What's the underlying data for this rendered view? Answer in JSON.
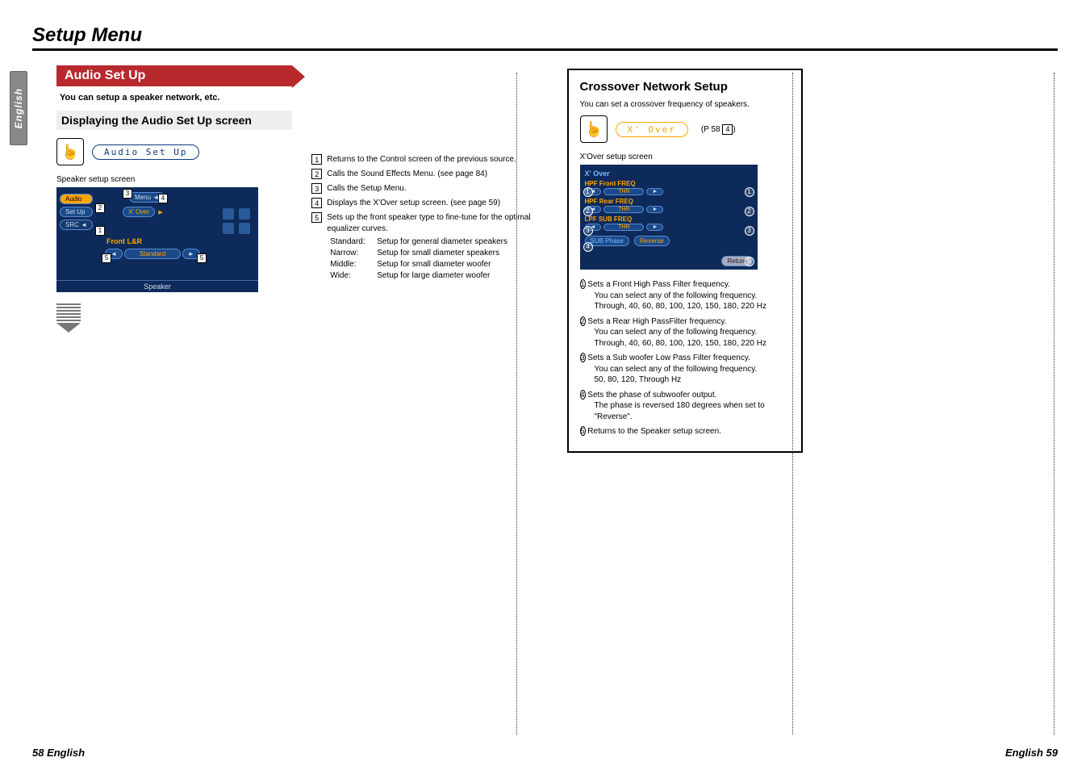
{
  "page_title": "Setup Menu",
  "english_tab": "English",
  "left_page": {
    "banner": "Audio Set Up",
    "intro": "You can setup a speaker network, etc.",
    "subheading": "Displaying the Audio Set Up screen",
    "button_pill": "Audio Set Up",
    "speaker_label": "Speaker setup screen",
    "screen": {
      "tabs": {
        "audio": "Audio",
        "setup": "Set Up",
        "src": "SRC"
      },
      "menu": "Menu",
      "xover": "X' Over",
      "front": "Front L&R",
      "standard": "Standard",
      "footer": "Speaker"
    },
    "items": [
      {
        "n": "1",
        "text": "Returns to the Control screen of the previous source."
      },
      {
        "n": "2",
        "text": "Calls the Sound Effects Menu. (see page 84)"
      },
      {
        "n": "3",
        "text": "Calls the Setup Menu."
      },
      {
        "n": "4",
        "text": "Displays the X'Over setup screen. (see page 59)"
      },
      {
        "n": "5",
        "text": "Sets up the front speaker type to fine-tune for the optimal equalizer curves.",
        "sub": [
          {
            "k": "Standard:",
            "v": "Setup for general diameter speakers"
          },
          {
            "k": "Narrow:",
            "v": "Setup for small diameter speakers"
          },
          {
            "k": "Middle:",
            "v": "Setup for small diameter woofer"
          },
          {
            "k": "Wide:",
            "v": "Setup for large diameter woofer"
          }
        ]
      }
    ]
  },
  "right": {
    "title": "Crossover Network Setup",
    "intro": "You can set a crossover frequency of speakers.",
    "pill": "X' Over",
    "pref_page": "(P 58",
    "pref_box": "4",
    "pref_close": ")",
    "screen_label": "X'Over setup screen",
    "screen": {
      "hdr": "X' Over",
      "hpf_front": "HPF  Front FREQ",
      "hpf_rear": "HPF  Rear  FREQ",
      "lpf_sub": "LPF SUB FREQ",
      "thr": "THR",
      "phase_label": "SUB Phase",
      "phase_val": "Reverse",
      "return": "Return"
    },
    "list": [
      {
        "n": "1",
        "title": "Sets a Front High Pass Filter frequency.",
        "desc": "You can select any of the following frequency.\nThrough, 40, 60, 80, 100, 120, 150, 180, 220 Hz"
      },
      {
        "n": "2",
        "title": "Sets a Rear High PassFilter frequency.",
        "desc": "You can select any of the following frequency.\nThrough, 40, 60, 80, 100, 120, 150, 180, 220 Hz"
      },
      {
        "n": "3",
        "title": "Sets a Sub woofer Low Pass Filter frequency.",
        "desc": "You can select any of the following frequency.\n50, 80, 120, Through Hz"
      },
      {
        "n": "4",
        "title": "Sets the phase of subwoofer output.",
        "desc": "The phase is reversed 180 degrees when set to \"Reverse\"."
      },
      {
        "n": "5",
        "title": "Returns to the Speaker setup screen.",
        "desc": ""
      }
    ]
  },
  "footer_left": "58 English",
  "footer_right": "English 59"
}
